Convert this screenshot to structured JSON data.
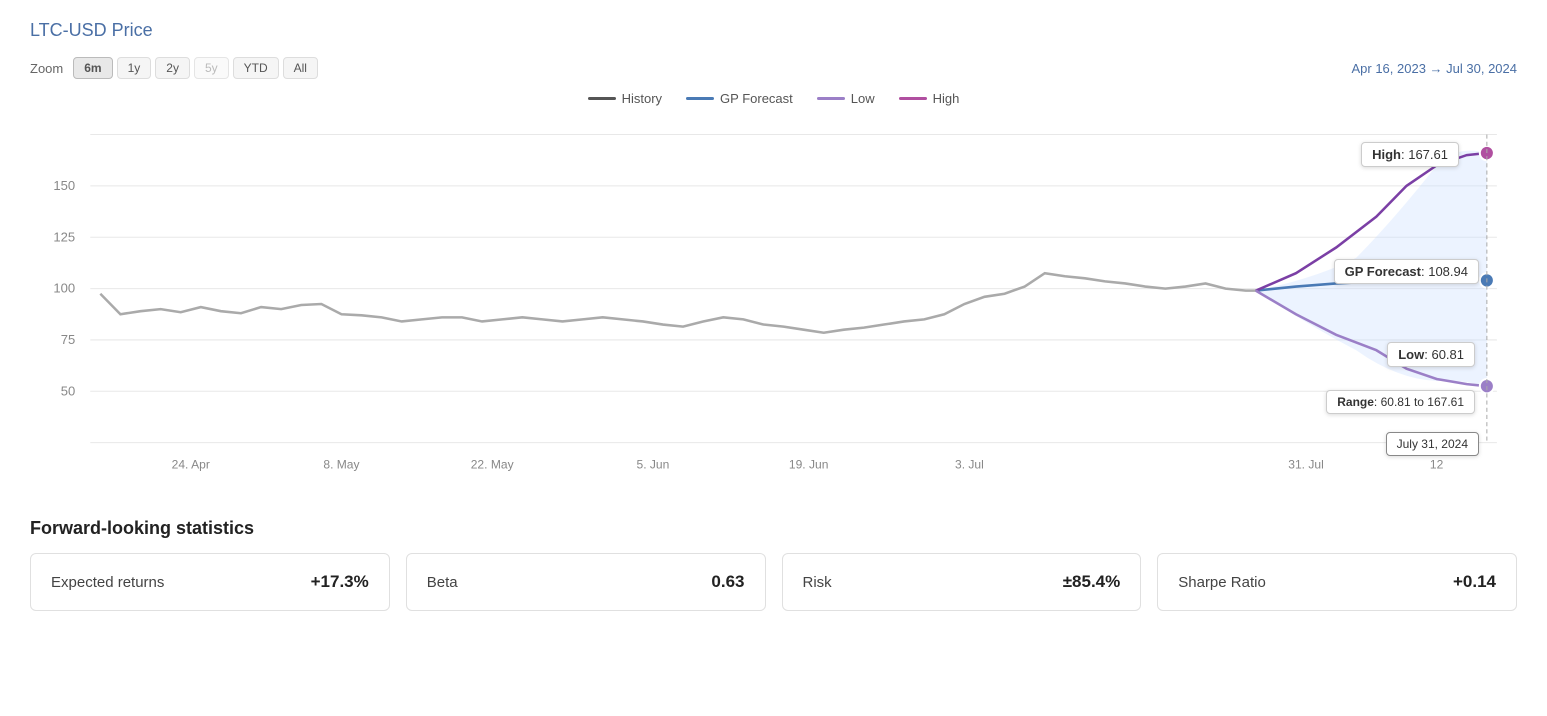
{
  "page": {
    "title": "LTC-USD Price"
  },
  "zoom": {
    "label": "Zoom",
    "buttons": [
      "6m",
      "1y",
      "2y",
      "5y",
      "YTD",
      "All"
    ],
    "active": "6m"
  },
  "dateRange": "Apr 16, 2023 → Jul 30, 2024",
  "legend": {
    "items": [
      {
        "key": "history",
        "label": "History",
        "class": "history"
      },
      {
        "key": "gp-forecast",
        "label": "GP Forecast",
        "class": "gp-forecast"
      },
      {
        "key": "low",
        "label": "Low",
        "class": "low"
      },
      {
        "key": "high",
        "label": "High",
        "class": "high"
      }
    ]
  },
  "tooltips": {
    "high": "High: 167.61",
    "gp": "GP Forecast: 108.94",
    "low": "Low: 60.81",
    "range": "Range: 60.81 to 167.61",
    "date": "July 31, 2024"
  },
  "xLabels": [
    "24. Apr",
    "8. May",
    "22. May",
    "5. Jun",
    "19. Jun",
    "3. Jul",
    "31. Jul",
    "12"
  ],
  "yLabels": [
    "50",
    "75",
    "100",
    "125",
    "150"
  ],
  "stats": {
    "title": "Forward-looking statistics",
    "cards": [
      {
        "label": "Expected returns",
        "value": "+17.3%"
      },
      {
        "label": "Beta",
        "value": "0.63"
      },
      {
        "label": "Risk",
        "value": "±85.4%"
      },
      {
        "label": "Sharpe Ratio",
        "value": "+0.14"
      }
    ]
  }
}
